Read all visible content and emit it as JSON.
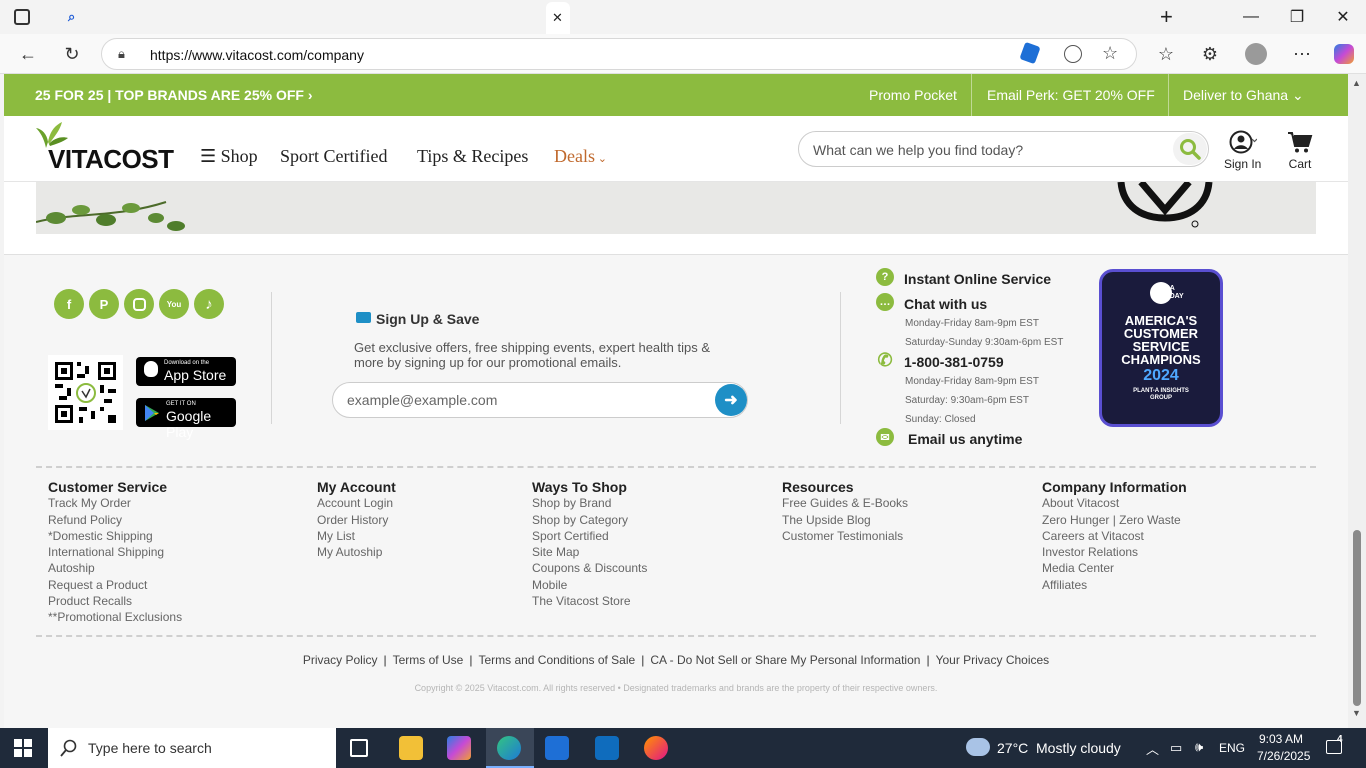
{
  "browser": {
    "url": "https://www.vitacost.com/company",
    "window_controls": {
      "minimize": "—",
      "maximize": "❐",
      "close": "✕"
    }
  },
  "promo_bar": {
    "headline": "25 FOR 25 | TOP BRANDS ARE 25% OFF",
    "links": [
      "Promo Pocket",
      "Email Perk: GET 20% OFF",
      "Deliver to Ghana"
    ],
    "color": "#8cbb3f"
  },
  "header": {
    "logo_text": "VITACOST",
    "nav": {
      "shop": "Shop",
      "sport": "Sport Certified",
      "tips": "Tips & Recipes",
      "deals": "Deals"
    },
    "search_placeholder": "What can we help you find today?",
    "sign_in": "Sign In",
    "cart": "Cart"
  },
  "social": {
    "icons": [
      "facebook-icon",
      "pinterest-icon",
      "instagram-icon",
      "youtube-icon",
      "tiktok-icon"
    ]
  },
  "app_badges": {
    "app_store_top": "Download on the",
    "app_store": "App Store",
    "google_top": "GET IT ON",
    "google": "Google Play"
  },
  "signup": {
    "title": "Sign Up & Save",
    "description": "Get exclusive offers, free shipping events, expert health tips & more by signing up for our promotional emails.",
    "placeholder": "example@example.com"
  },
  "contact": {
    "instant": "Instant Online Service",
    "chat": "Chat with us",
    "chat_hours_1": "Monday-Friday 8am-9pm EST",
    "chat_hours_2": "Saturday-Sunday 9:30am-6pm EST",
    "phone": "1-800-381-0759",
    "phone_hours_1": "Monday-Friday 8am-9pm EST",
    "phone_hours_2": "Saturday: 9:30am-6pm EST",
    "phone_hours_3": "Sunday: Closed",
    "email": "Email us anytime"
  },
  "award": {
    "brand": "USA TODAY",
    "line1": "AMERICA'S",
    "line2": "CUSTOMER",
    "line3": "SERVICE",
    "line4": "CHAMPIONS",
    "year": "2024",
    "partner": "PLANT-A INSIGHTS GROUP"
  },
  "footer_columns": [
    {
      "heading": "Customer Service",
      "links": [
        "Track My Order",
        "Refund Policy",
        "*Domestic Shipping",
        "International Shipping",
        "Autoship",
        "Request a Product",
        "Product Recalls",
        "**Promotional Exclusions"
      ]
    },
    {
      "heading": "My Account",
      "links": [
        "Account Login",
        "Order History",
        "My List",
        "My Autoship"
      ]
    },
    {
      "heading": "Ways To Shop",
      "links": [
        "Shop by Brand",
        "Shop by Category",
        "Sport Certified",
        "Site Map",
        "Coupons & Discounts",
        "Mobile",
        "The Vitacost Store"
      ]
    },
    {
      "heading": "Resources",
      "links": [
        "Free Guides & E-Books",
        "The Upside Blog",
        "Customer Testimonials"
      ]
    },
    {
      "heading": "Company Information",
      "links": [
        "About Vitacost",
        "Zero Hunger | Zero Waste",
        "Careers at Vitacost",
        "Investor Relations",
        "Media Center",
        "Affiliates"
      ]
    }
  ],
  "legal": {
    "privacy": "Privacy Policy",
    "terms": "Terms of Use",
    "tcs": "Terms and Conditions of Sale",
    "ca": "CA - Do Not Sell or Share My Personal Information",
    "choices": "Your Privacy Choices",
    "copyright": "Copyright © 2025 Vitacost.com. All rights reserved • Designated trademarks and brands are the property of their respective owners."
  },
  "taskbar": {
    "search_placeholder": "Type here to search",
    "temperature": "27°C",
    "weather": "Mostly cloudy",
    "lang": "ENG",
    "time": "9:03 AM",
    "date": "7/26/2025",
    "notifications": "4"
  }
}
